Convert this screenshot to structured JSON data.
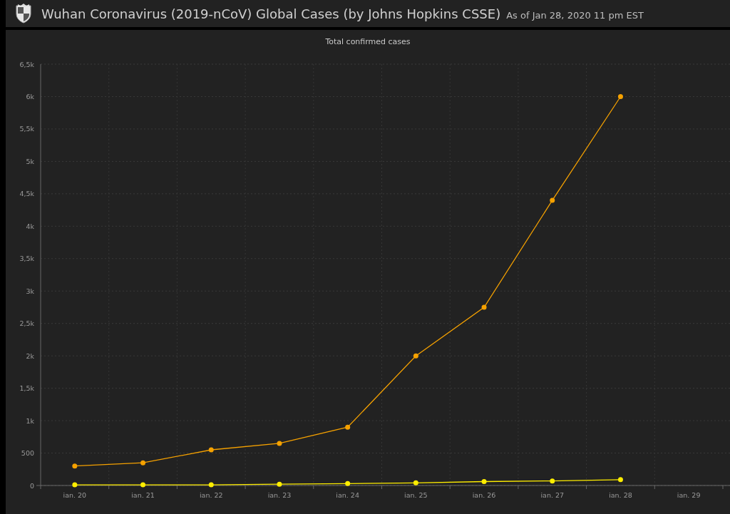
{
  "header": {
    "title": "Wuhan Coronavirus (2019-nCoV) Global Cases (by Johns Hopkins CSSE)",
    "subtitle": "As of Jan 28, 2020 11 pm EST"
  },
  "chart": {
    "chart_data": {
      "type": "line",
      "title": "Total confirmed cases",
      "categories": [
        "ian. 20",
        "ian. 21",
        "ian. 22",
        "ian. 23",
        "ian. 24",
        "ian. 25",
        "ian. 26",
        "ian. 27",
        "ian. 28",
        "ian. 29"
      ],
      "series": [
        {
          "color": "#f5a100",
          "marker": true,
          "values": [
            300,
            350,
            550,
            650,
            900,
            2000,
            2750,
            4400,
            6000,
            null
          ]
        },
        {
          "color": "#ffee00",
          "marker": true,
          "values": [
            10,
            10,
            10,
            20,
            30,
            40,
            60,
            70,
            90,
            null
          ]
        }
      ],
      "grid": true,
      "ylim": [
        0,
        6500
      ],
      "yticks": [
        {
          "value": 0,
          "label": "0"
        },
        {
          "value": 500,
          "label": "500"
        },
        {
          "value": 1000,
          "label": "1k"
        },
        {
          "value": 1500,
          "label": "1,5k"
        },
        {
          "value": 2000,
          "label": "2k"
        },
        {
          "value": 2500,
          "label": "2,5k"
        },
        {
          "value": 3000,
          "label": "3k"
        },
        {
          "value": 3500,
          "label": "3,5k"
        },
        {
          "value": 4000,
          "label": "4k"
        },
        {
          "value": 4500,
          "label": "4,5k"
        },
        {
          "value": 5000,
          "label": "5k"
        },
        {
          "value": 5500,
          "label": "5,5k"
        },
        {
          "value": 6000,
          "label": "6k"
        },
        {
          "value": 6500,
          "label": "6,5k"
        }
      ]
    }
  }
}
